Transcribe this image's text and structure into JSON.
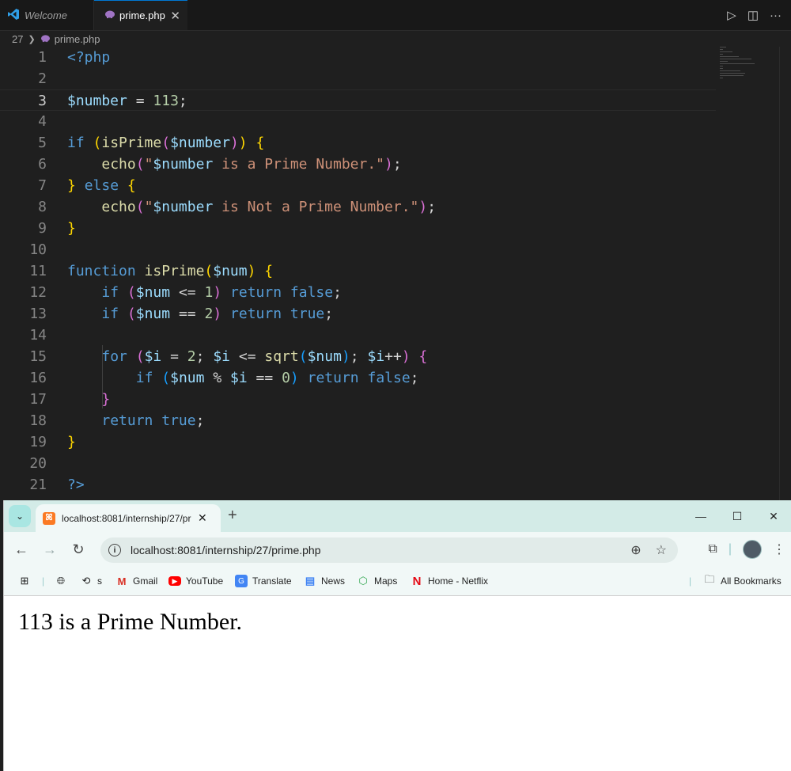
{
  "vscode": {
    "tabs": [
      {
        "label": "Welcome",
        "active": false
      },
      {
        "label": "prime.php",
        "active": true
      }
    ],
    "breadcrumb": {
      "folder": "27",
      "file": "prime.php"
    },
    "colors": {
      "keyword": "#569cd6",
      "control": "#c586c0",
      "function": "#dcdcaa",
      "string": "#ce9178",
      "number": "#b5cea8",
      "bracket1": "#ffd700",
      "bracket2": "#da70d6",
      "bracket3": "#179fff",
      "text": "#d4d4d4"
    },
    "code_lines": [
      {
        "n": "1",
        "text": "<?php"
      },
      {
        "n": "2",
        "text": ""
      },
      {
        "n": "3",
        "text": "$number = 113;"
      },
      {
        "n": "4",
        "text": ""
      },
      {
        "n": "5",
        "text": "if (isPrime($number)) {"
      },
      {
        "n": "6",
        "text": "    echo(\"$number is a Prime Number.\");"
      },
      {
        "n": "7",
        "text": "} else {"
      },
      {
        "n": "8",
        "text": "    echo(\"$number is Not a Prime Number.\");"
      },
      {
        "n": "9",
        "text": "}"
      },
      {
        "n": "10",
        "text": ""
      },
      {
        "n": "11",
        "text": "function isPrime($num) {"
      },
      {
        "n": "12",
        "text": "    if ($num <= 1) return false;"
      },
      {
        "n": "13",
        "text": "    if ($num == 2) return true;"
      },
      {
        "n": "14",
        "text": ""
      },
      {
        "n": "15",
        "text": "    for ($i = 2; $i <= sqrt($num); $i++) {"
      },
      {
        "n": "16",
        "text": "        if ($num % $i == 0) return false;"
      },
      {
        "n": "17",
        "text": "    }"
      },
      {
        "n": "18",
        "text": "    return true;"
      },
      {
        "n": "19",
        "text": "}"
      },
      {
        "n": "20",
        "text": ""
      },
      {
        "n": "21",
        "text": "?>"
      }
    ]
  },
  "browser": {
    "tab_title": "localhost:8081/internship/27/pr",
    "url": "localhost:8081/internship/27/prime.php",
    "bookmarks": [
      "s",
      "Gmail",
      "YouTube",
      "Translate",
      "News",
      "Maps",
      "Home - Netflix"
    ],
    "all_bookmarks": "All Bookmarks",
    "output": "113 is a Prime Number."
  }
}
